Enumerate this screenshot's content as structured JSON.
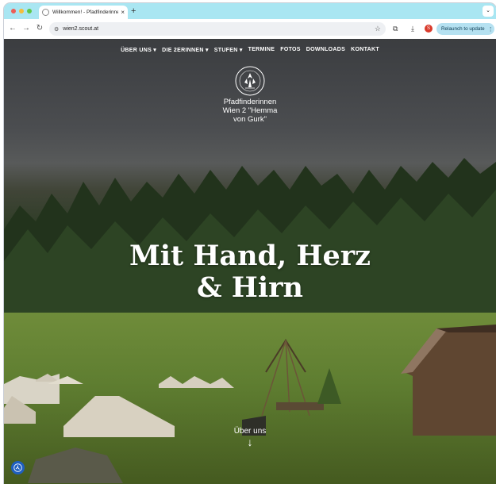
{
  "browser": {
    "tab_title": "Willkommen! - Pfadfinderinnen",
    "tab_close": "×",
    "new_tab": "+",
    "url": "wien2.scout.at",
    "relaunch_label": "Relaunch to update",
    "profile_badge": "S",
    "relaunch_menu": "⋮"
  },
  "site": {
    "nav": [
      {
        "label": "ÜBER UNS ▾"
      },
      {
        "label": "DIE 2ERINNEN ▾"
      },
      {
        "label": "STUFEN ▾"
      },
      {
        "label": "TERMINE"
      },
      {
        "label": "FOTOS"
      },
      {
        "label": "DOWNLOADS"
      },
      {
        "label": "KONTAKT"
      }
    ],
    "logo_text": "HEMMA VON GURK",
    "name": "Pfadfinderinnen\nWien 2 \"Hemma\nvon Gurk\"",
    "hero_title": "Mit Hand, Herz\n& Hirn",
    "about_link": "Über uns",
    "down_arrow": "↓"
  },
  "colors": {
    "tabstrip": "#a9e6f2",
    "relaunch_bg": "#b5e1f1",
    "a11y_button": "#1f5fbf"
  }
}
